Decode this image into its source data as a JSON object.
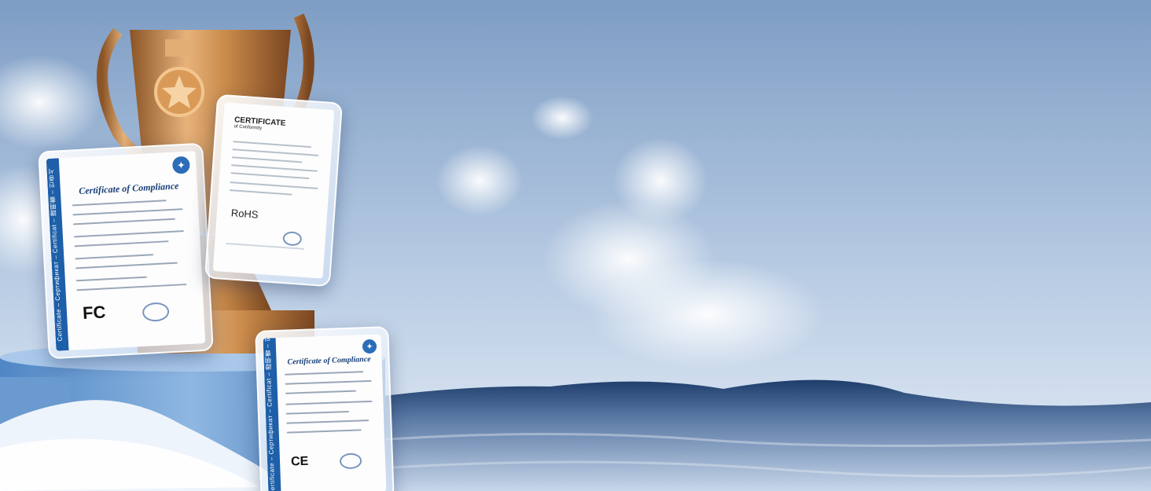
{
  "certificates": {
    "fcc": {
      "title": "Certificate of Compliance",
      "band": "Certificate – Сертификат – Certificat – 證明書 – 인증서",
      "mark": "FC"
    },
    "rohs": {
      "heading": "CERTIFICATE",
      "subheading": "of Conformity",
      "mark": "RoHS"
    },
    "ce": {
      "title": "Certificate of Compliance",
      "band": "Certificate – Сертификат – Certificat – 證明書 – 인증서",
      "mark": "CE"
    }
  },
  "colors": {
    "sky_top": "#7e9dc4",
    "sky_bottom": "#dde8f5",
    "sea_dark": "#1e3d6b",
    "sea_light": "#b9cce3",
    "trophy_gold": "#c98a4a",
    "cert_blue": "#1d5fa8"
  }
}
